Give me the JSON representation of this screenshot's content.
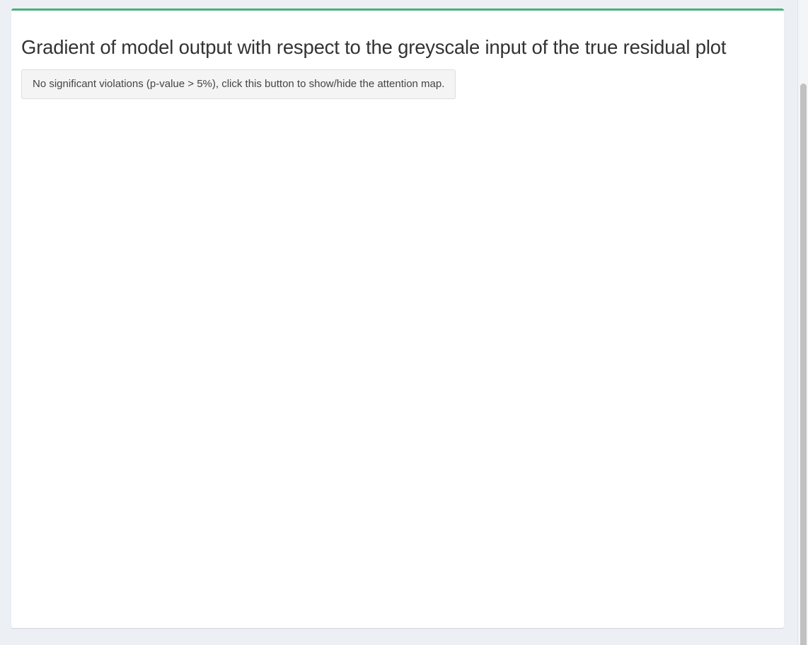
{
  "panel": {
    "title": "Gradient of model output with respect to the greyscale input of the true residual plot",
    "toggle_button_label": "No significant violations (p-value > 5%), click this button to show/hide the attention map.",
    "attention_map_visible": false
  },
  "colors": {
    "page_background": "#ecf0f5",
    "panel_background": "#ffffff",
    "panel_top_border": "#4caf7a",
    "button_background": "#f4f4f4",
    "title_text": "#333333"
  }
}
